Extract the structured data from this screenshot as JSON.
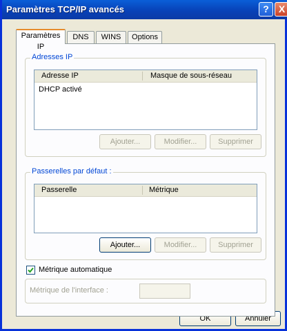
{
  "window": {
    "title": "Paramètres TCP/IP avancés",
    "help_glyph": "?",
    "close_glyph": "X"
  },
  "tabs": [
    {
      "label": "Paramètres IP",
      "active": true
    },
    {
      "label": "DNS",
      "active": false
    },
    {
      "label": "WINS",
      "active": false
    },
    {
      "label": "Options",
      "active": false
    }
  ],
  "ip_group": {
    "title": "Adresses IP",
    "columns": [
      "Adresse IP",
      "Masque de sous-réseau"
    ],
    "rows": [
      [
        "DHCP activé",
        ""
      ]
    ],
    "buttons": {
      "add": "Ajouter...",
      "edit": "Modifier...",
      "remove": "Supprimer"
    }
  },
  "gateway_group": {
    "title": "Passerelles par défaut :",
    "columns": [
      "Passerelle",
      "Métrique"
    ],
    "buttons": {
      "add": "Ajouter...",
      "edit": "Modifier...",
      "remove": "Supprimer"
    }
  },
  "auto_metric": {
    "label": "Métrique automatique",
    "checked": true
  },
  "interface_metric": {
    "label": "Métrique de l'interface :",
    "value": ""
  },
  "footer": {
    "ok": "OK",
    "cancel": "Annuler"
  },
  "colors": {
    "title_bar": "#0842b8",
    "group_label": "#0046d5",
    "disabled_text": "#a1a192"
  }
}
